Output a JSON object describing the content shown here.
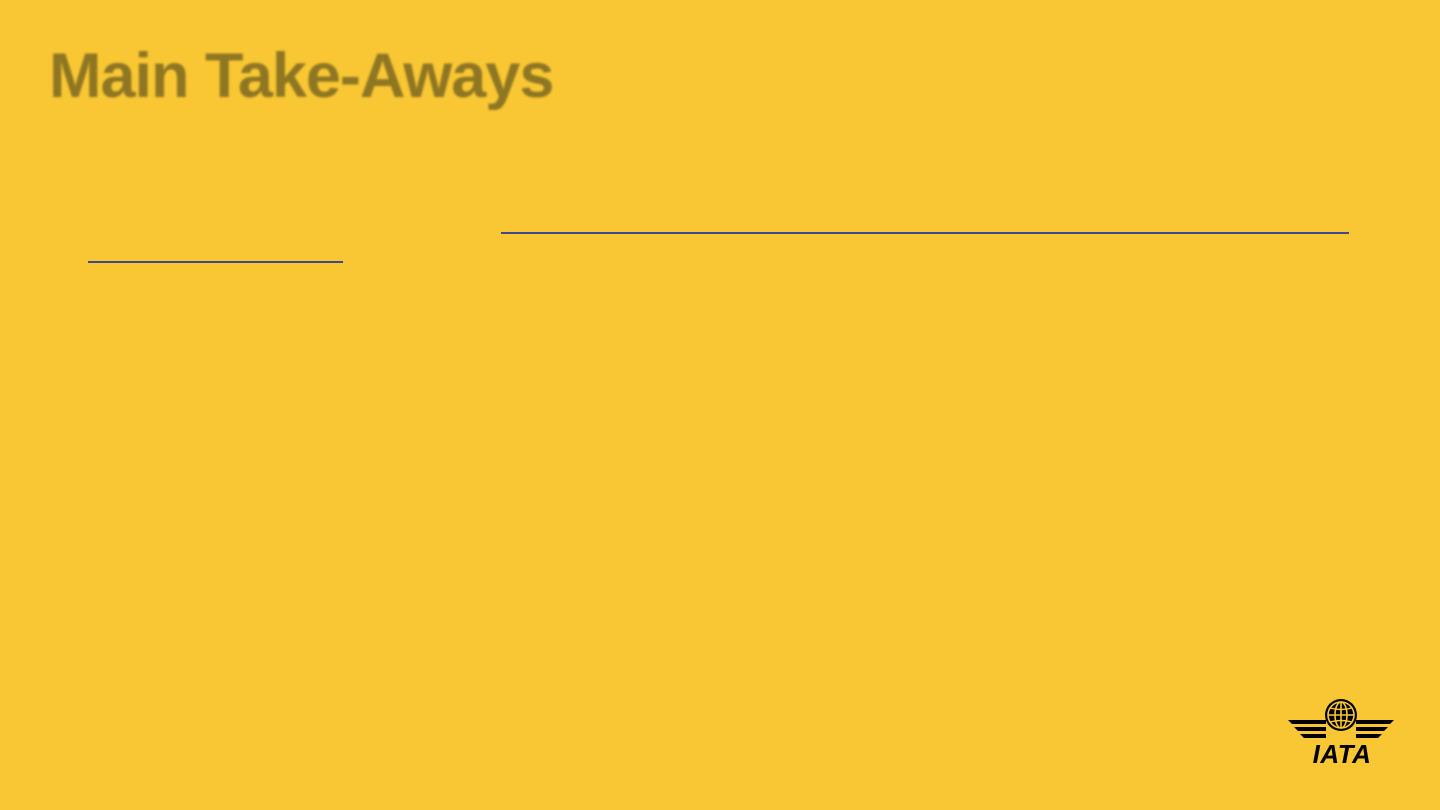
{
  "slide": {
    "title": "Main Take-Aways",
    "background_color": "#F9C733",
    "title_color": "#8F7623",
    "link_color": "#3F4A8C"
  },
  "logo": {
    "text": "IATA",
    "icon": "iata-globe-wings-icon"
  }
}
